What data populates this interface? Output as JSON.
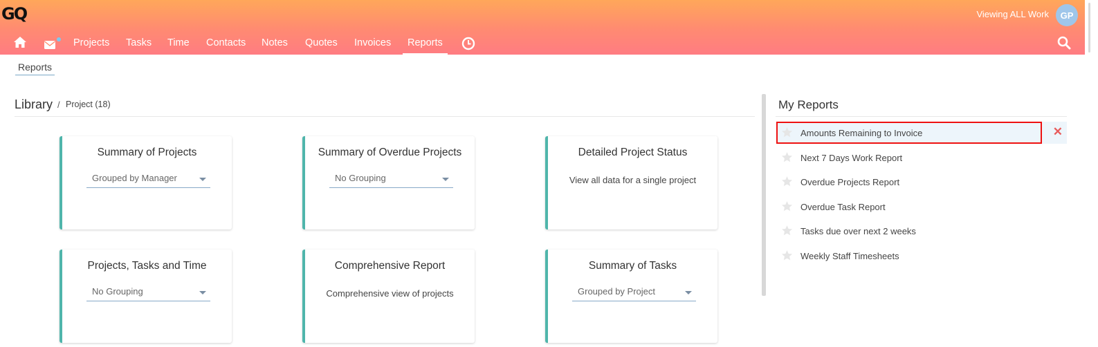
{
  "app": {
    "logo": "GQ"
  },
  "header": {
    "viewing_label": "Viewing ALL Work",
    "avatar_initials": "GP"
  },
  "nav": {
    "items": [
      {
        "label": "Projects"
      },
      {
        "label": "Tasks"
      },
      {
        "label": "Time"
      },
      {
        "label": "Contacts"
      },
      {
        "label": "Notes"
      },
      {
        "label": "Quotes"
      },
      {
        "label": "Invoices"
      },
      {
        "label": "Reports",
        "active": true
      }
    ],
    "icons": [
      "home-icon",
      "mail-icon",
      "clock-icon",
      "search-icon"
    ]
  },
  "breadcrumb": {
    "label": "Reports"
  },
  "library": {
    "title": "Library",
    "separator": "/",
    "subtitle": "Project (18)",
    "cards": [
      {
        "title": "Summary of Projects",
        "select": "Grouped by Manager"
      },
      {
        "title": "Summary of Overdue Projects",
        "select": "No Grouping"
      },
      {
        "title": "Detailed Project Status",
        "description": "View all data for a single project"
      },
      {
        "title": "Projects, Tasks and Time",
        "select": "No Grouping"
      },
      {
        "title": "Comprehensive Report",
        "description": "Comprehensive view of projects"
      },
      {
        "title": "Summary of Tasks",
        "select": "Grouped by Project"
      }
    ]
  },
  "my_reports": {
    "title": "My Reports",
    "items": [
      {
        "label": "Amounts Remaining to Invoice",
        "selected": true,
        "remove": "✕"
      },
      {
        "label": "Next 7 Days Work Report"
      },
      {
        "label": "Overdue Projects Report"
      },
      {
        "label": "Overdue Task Report"
      },
      {
        "label": "Tasks due over next 2 weeks"
      },
      {
        "label": "Weekly Staff Timesheets"
      }
    ]
  },
  "colors": {
    "accent": "#4fb5ab",
    "header_from": "#ffa75a",
    "header_to": "#ff7c82",
    "remove": "#e85b5b",
    "highlight": "#ee1111"
  }
}
